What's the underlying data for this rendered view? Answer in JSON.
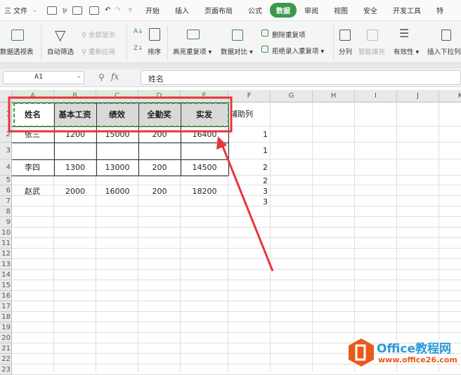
{
  "menubar": {
    "file": "三 文件",
    "tabs": [
      "开始",
      "插入",
      "页面布局",
      "公式",
      "数据",
      "审阅",
      "视图",
      "安全",
      "开发工具",
      "特"
    ],
    "active_tab": "数据"
  },
  "ribbon": {
    "pivot": "数据透视表",
    "autofilter": "自动筛选",
    "show_all": "全部显示",
    "reapply": "重新应用",
    "sort": "排序",
    "highlight_dup": "高亮重复项",
    "compare": "数据对比",
    "delete_dup": "删除重复项",
    "reject_dup": "拒绝录入重复项",
    "split": "分列",
    "smart_fill": "智能填充",
    "validity": "有效性",
    "dropdown": "插入下拉列"
  },
  "formula_bar": {
    "name_box": "A1",
    "fx": "fx",
    "value": "姓名"
  },
  "columns": [
    "A",
    "B",
    "C",
    "D",
    "E",
    "F",
    "G",
    "H",
    "I",
    "J",
    "K"
  ],
  "table": {
    "headers": [
      "姓名",
      "基本工资",
      "绩效",
      "全勤奖",
      "实发",
      "辅助列"
    ],
    "rows": [
      {
        "name": "张三",
        "base": "1200",
        "perf": "15000",
        "att": "200",
        "pay": "16400",
        "aux": "1"
      },
      {
        "name": "",
        "base": "",
        "perf": "",
        "att": "",
        "pay": "",
        "aux": "1"
      },
      {
        "name": "李四",
        "base": "1300",
        "perf": "13000",
        "att": "200",
        "pay": "14500",
        "aux": "2"
      },
      {
        "name": "",
        "base": "",
        "perf": "",
        "att": "",
        "pay": "",
        "aux": "2"
      },
      {
        "name": "赵武",
        "base": "2000",
        "perf": "16000",
        "att": "200",
        "pay": "18200",
        "aux": "3"
      },
      {
        "name": "",
        "base": "",
        "perf": "",
        "att": "",
        "pay": "",
        "aux": "3"
      }
    ]
  },
  "watermark": {
    "title": "Office教程网",
    "url": "www.office26.com"
  },
  "colors": {
    "accent": "#3a9a4a",
    "annotation": "#e8343a",
    "logo": "#e85a1a",
    "logo_text": "#2a9ad8"
  }
}
